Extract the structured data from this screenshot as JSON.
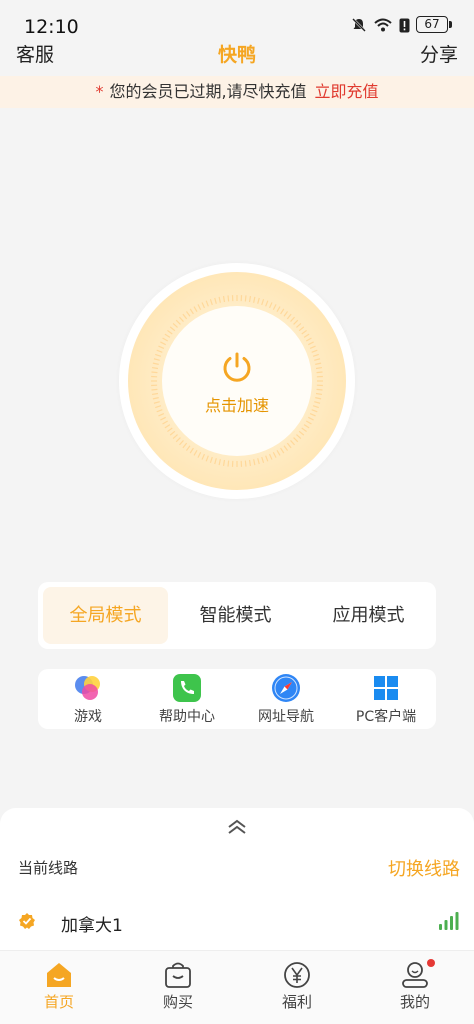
{
  "status_bar": {
    "time": "12:10",
    "battery": "67"
  },
  "header": {
    "left": "客服",
    "title": "快鸭",
    "right": "分享"
  },
  "notice": {
    "star": "*",
    "text": "您的会员已过期,请尽快充值",
    "link": "立即充值"
  },
  "accelerate": {
    "label": "点击加速",
    "icon": "power-icon"
  },
  "modes": [
    {
      "label": "全局模式",
      "active": true
    },
    {
      "label": "智能模式",
      "active": false
    },
    {
      "label": "应用模式",
      "active": false
    }
  ],
  "shortcuts": [
    {
      "label": "游戏",
      "icon": "game-icon"
    },
    {
      "label": "帮助中心",
      "icon": "phone-icon"
    },
    {
      "label": "网址导航",
      "icon": "compass-icon"
    },
    {
      "label": "PC客户端",
      "icon": "windows-icon"
    }
  ],
  "route": {
    "current_label": "当前线路",
    "switch_label": "切换线路",
    "name": "加拿大1",
    "signal_level": 4
  },
  "tabbar": [
    {
      "label": "首页",
      "icon": "home-icon",
      "active": true
    },
    {
      "label": "购买",
      "icon": "bag-icon",
      "active": false
    },
    {
      "label": "福利",
      "icon": "yen-icon",
      "active": false
    },
    {
      "label": "我的",
      "icon": "profile-icon",
      "active": false
    }
  ],
  "colors": {
    "accent": "#f5a623",
    "alert": "#e03a2f",
    "signal": "#4caf50"
  }
}
